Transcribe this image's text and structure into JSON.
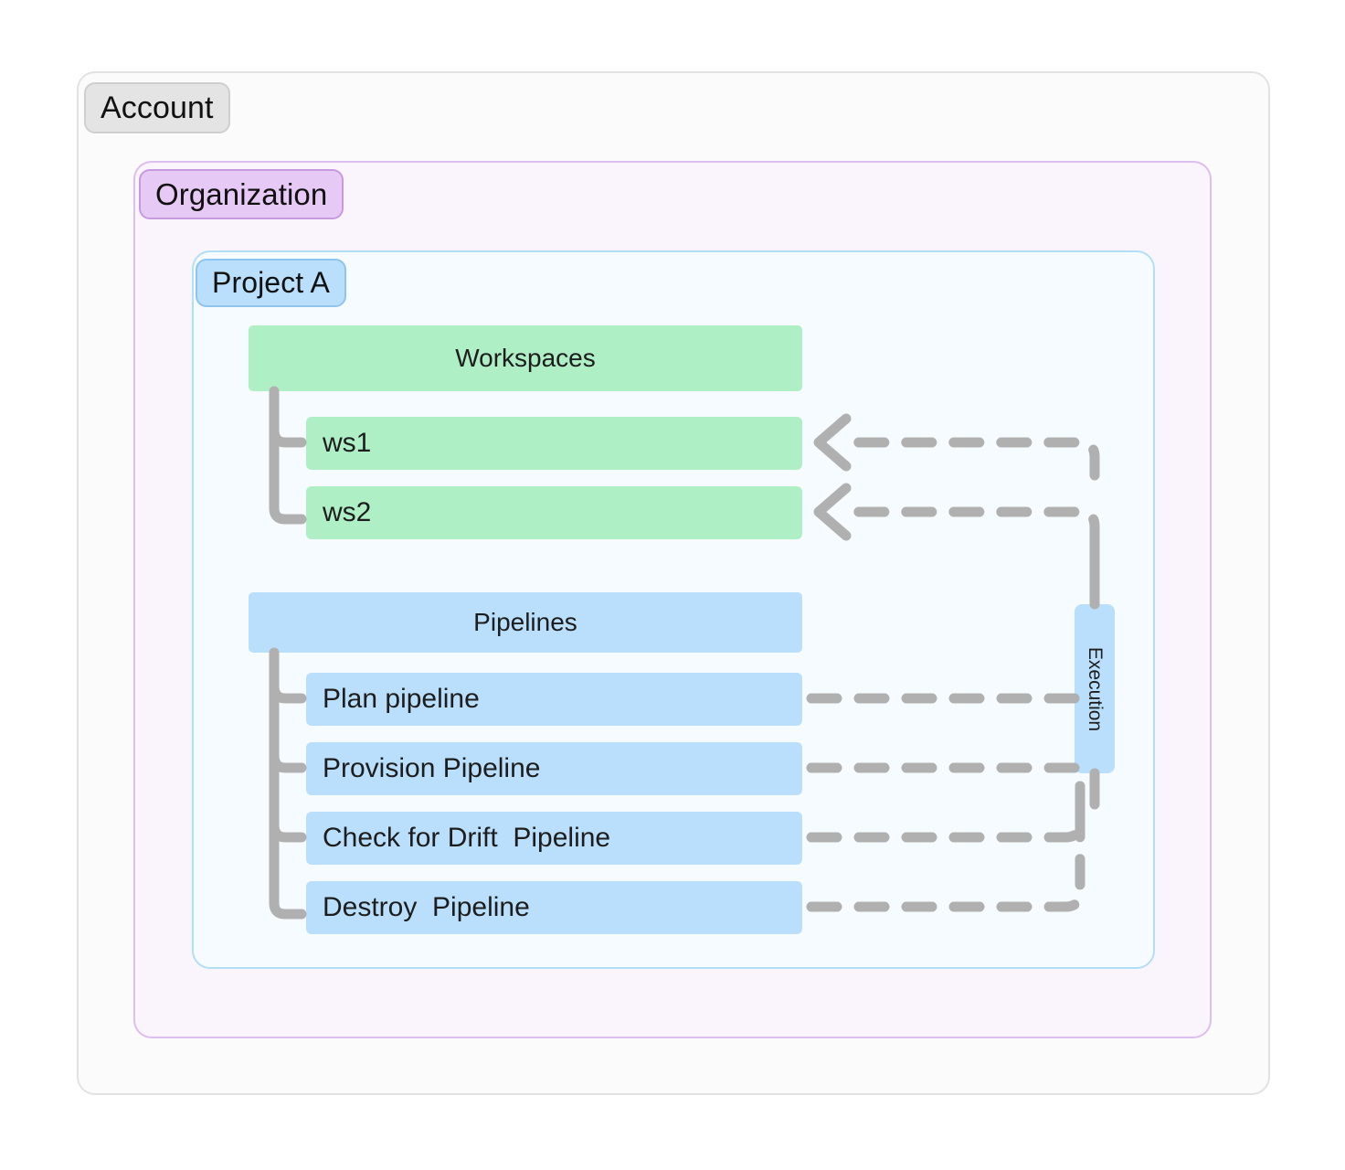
{
  "containers": {
    "account": {
      "label": "Account"
    },
    "organization": {
      "label": "Organization"
    },
    "project": {
      "label": "Project A"
    }
  },
  "groups": {
    "workspaces": {
      "header": "Workspaces",
      "items": [
        {
          "label": "ws1"
        },
        {
          "label": "ws2"
        }
      ]
    },
    "pipelines": {
      "header": "Pipelines",
      "items": [
        {
          "label": "Plan pipeline"
        },
        {
          "label": "Provision Pipeline"
        },
        {
          "label": "Check for Drift  Pipeline"
        },
        {
          "label": "Destroy  Pipeline"
        }
      ]
    }
  },
  "execution": {
    "label": "Execution"
  },
  "colors": {
    "workspace_fill": "#aeefc5",
    "pipeline_fill": "#b9dffc",
    "account_chip": "#e4e4e4",
    "organization_chip": "#e7c9f5",
    "project_chip": "#b9dffc",
    "organization_border": "#dcbef0",
    "project_border": "#b3dff5",
    "account_border": "#e2e2e2",
    "connector": "#b0b0b0"
  }
}
